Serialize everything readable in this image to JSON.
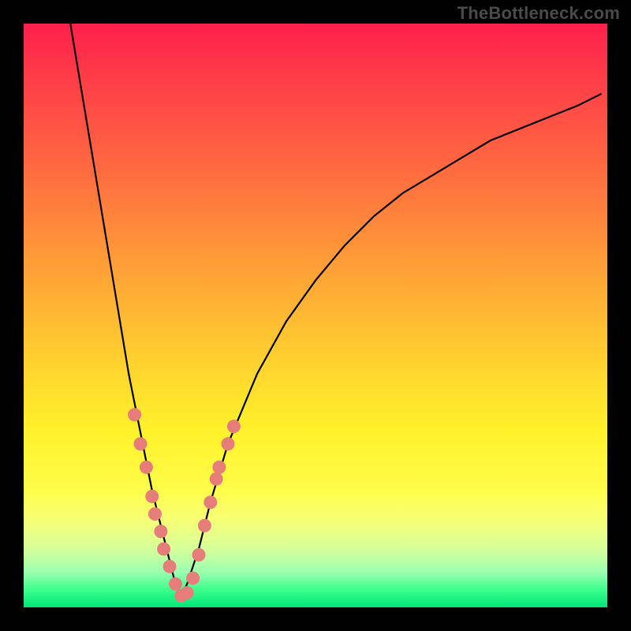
{
  "watermark": "TheBottleneck.com",
  "colors": {
    "frame_border": "#000000",
    "curve": "#000000",
    "marker": "#e77d7a",
    "gradient_top": "#ff1f4a",
    "gradient_bottom": "#00e676"
  },
  "chart_data": {
    "type": "line",
    "title": "",
    "xlabel": "",
    "ylabel": "",
    "xlim": [
      0,
      100
    ],
    "ylim": [
      0,
      100
    ],
    "note": "axes unlabeled; values are relative positions on the plot area (0–100). y=0 at bottom (green), y=100 at top (red). Curve is an asymmetric V: steep left branch, shallower right branch, minimum near x≈27.",
    "series": [
      {
        "name": "curve-left-branch",
        "x": [
          8,
          10,
          12,
          14,
          16,
          18,
          20,
          22,
          24,
          25,
          26,
          27
        ],
        "y": [
          100,
          88,
          76,
          64,
          52,
          40,
          30,
          20,
          12,
          8,
          4,
          2
        ]
      },
      {
        "name": "curve-right-branch",
        "x": [
          27,
          28,
          30,
          32,
          35,
          40,
          45,
          50,
          55,
          60,
          65,
          70,
          75,
          80,
          85,
          90,
          95,
          99
        ],
        "y": [
          2,
          4,
          10,
          18,
          28,
          40,
          49,
          56,
          62,
          67,
          71,
          74,
          77,
          80,
          82,
          84,
          86,
          88
        ]
      }
    ],
    "markers": {
      "name": "data-points",
      "note": "salmon circular markers clustered near the valley on both branches",
      "points": [
        {
          "x": 19,
          "y": 33
        },
        {
          "x": 20,
          "y": 28
        },
        {
          "x": 21,
          "y": 24
        },
        {
          "x": 22,
          "y": 19
        },
        {
          "x": 22.5,
          "y": 16
        },
        {
          "x": 23.5,
          "y": 13
        },
        {
          "x": 24,
          "y": 10
        },
        {
          "x": 25,
          "y": 7
        },
        {
          "x": 26,
          "y": 4
        },
        {
          "x": 27,
          "y": 2
        },
        {
          "x": 28,
          "y": 2.5
        },
        {
          "x": 29,
          "y": 5
        },
        {
          "x": 30,
          "y": 9
        },
        {
          "x": 31,
          "y": 14
        },
        {
          "x": 32,
          "y": 18
        },
        {
          "x": 33,
          "y": 22
        },
        {
          "x": 33.5,
          "y": 24
        },
        {
          "x": 35,
          "y": 28
        },
        {
          "x": 36,
          "y": 31
        }
      ]
    }
  }
}
